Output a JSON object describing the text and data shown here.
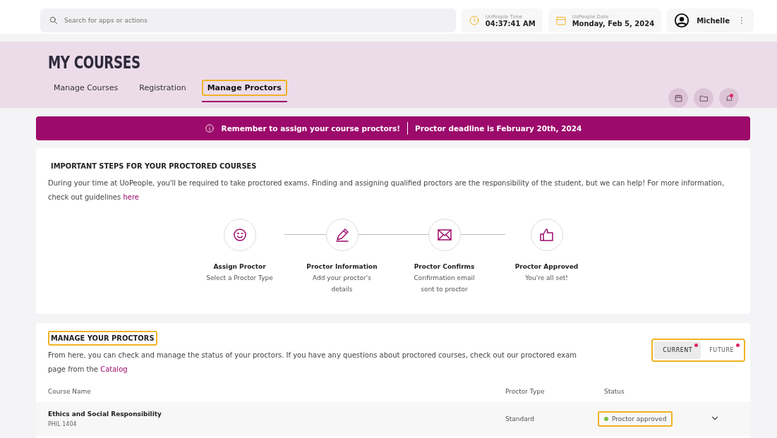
{
  "topbar": {
    "search": {
      "placeholder": "Search for apps or actions"
    },
    "time": {
      "label": "UoPeople Time",
      "value": "04:37:41 AM"
    },
    "date": {
      "label": "UoPeople Date",
      "value": "Monday, Feb 5, 2024"
    },
    "user": {
      "name": "Michelle"
    }
  },
  "header": {
    "title": "MY COURSES",
    "tabs": [
      {
        "label": "Manage Courses",
        "selected": false,
        "highlighted": false
      },
      {
        "label": "Registration",
        "selected": false,
        "highlighted": false
      },
      {
        "label": "Manage Proctors",
        "selected": true,
        "highlighted": true
      }
    ],
    "notification_dot": true
  },
  "banner": {
    "message": "Remember to assign your course proctors!",
    "deadline": "Proctor deadline is February 20th, 2024"
  },
  "steps_card": {
    "title": "IMPORTANT STEPS FOR YOUR PROCTORED COURSES",
    "text": "During your time at UoPeople, you'll be required to take proctored exams. Finding and assigning qualified proctors are the responsibility of the student, but we can help! For more information, check out guidelines ",
    "link": "here",
    "steps": [
      {
        "kind": "smile",
        "title": "Assign Proctor",
        "description": "Select a Proctor Type"
      },
      {
        "kind": "pencil",
        "title": "Proctor Information",
        "description": "Add your proctor's details"
      },
      {
        "kind": "envelope",
        "title": "Proctor Confirms",
        "description": "Confirmation email sent to proctor"
      },
      {
        "kind": "thumb",
        "title": "Proctor Approved",
        "description": "You're all set!"
      }
    ]
  },
  "proctors_card": {
    "title": "MANAGE YOUR PROCTORS",
    "title_highlighted": true,
    "text": "From here, you can check and manage the status of your proctors. If you have any questions about proctored courses, check out our proctored exam page from the ",
    "link": "Catalog",
    "toggle": {
      "highlighted": true,
      "options": [
        {
          "label": "CURRENT",
          "selected": true,
          "dot": true
        },
        {
          "label": "FUTURE",
          "selected": false,
          "dot": true
        }
      ]
    },
    "columns": [
      "Course Name",
      "Proctor Type",
      "Status"
    ],
    "rows": [
      {
        "course": "Ethics and Social Responsibility",
        "code": "PHIL 1404",
        "proctor_type": "Standard",
        "status": "Proctor approved",
        "color": "#7cc242",
        "highlighted": true,
        "expanded": false
      }
    ]
  }
}
